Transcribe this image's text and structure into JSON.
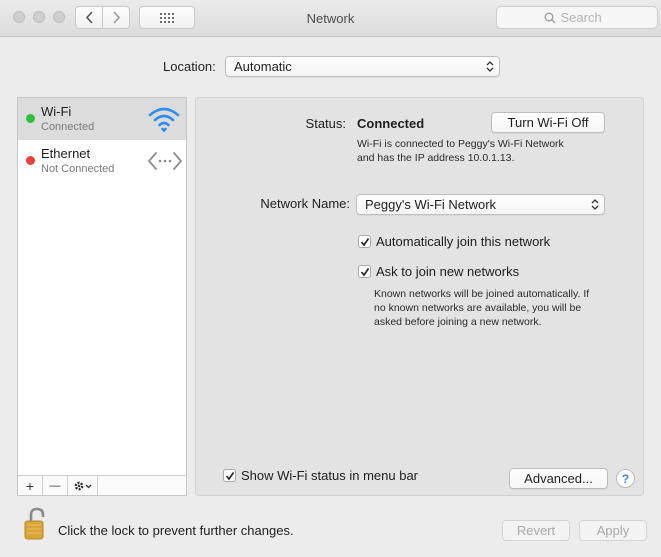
{
  "window": {
    "title": "Network",
    "search_placeholder": "Search",
    "traffic_lights": [
      "close",
      "minimize",
      "zoom"
    ],
    "nav_back_icon": "chevron-left-icon",
    "nav_forward_icon": "chevron-right-icon",
    "grid_icon": "grid-icon"
  },
  "location": {
    "label": "Location:",
    "value": "Automatic"
  },
  "services": [
    {
      "name": "Wi-Fi",
      "status": "Connected",
      "status_color": "#2fbe3b",
      "icon": "wifi-icon",
      "selected": true
    },
    {
      "name": "Ethernet",
      "status": "Not Connected",
      "status_color": "#ef3d3d",
      "icon": "ethernet-icon",
      "selected": false
    }
  ],
  "list_toolbar": {
    "add": "+",
    "remove": "—",
    "action_icon": "gear-icon"
  },
  "detail": {
    "status_label": "Status:",
    "status_value": "Connected",
    "turn_off_button": "Turn Wi-Fi Off",
    "status_desc_line1": "Wi-Fi is connected to Peggy's Wi-Fi Network",
    "status_desc_line2": "and has the IP address 10.0.1.13.",
    "network_name_label": "Network Name:",
    "network_name_value": "Peggy's Wi-Fi Network",
    "auto_join_label": "Automatically join this network",
    "auto_join_checked": true,
    "ask_join_label": "Ask to join new networks",
    "ask_join_checked": true,
    "ask_desc_line1": "Known networks will be joined automatically. If",
    "ask_desc_line2": "no known networks are available, you will be",
    "ask_desc_line3": "asked before joining a new network.",
    "show_status_label": "Show Wi-Fi status in menu bar",
    "show_status_checked": true,
    "advanced_button": "Advanced...",
    "help_button": "?"
  },
  "footer": {
    "lock_text": "Click the lock to prevent further changes.",
    "lock_icon": "unlocked-padlock-icon",
    "revert_button": "Revert",
    "apply_button": "Apply"
  },
  "colors": {
    "accent_blue": "#3a82f6",
    "connected_green": "#2fbe3b",
    "disconnected_red": "#ef3d3d",
    "lock_gold": "#d9a635"
  }
}
